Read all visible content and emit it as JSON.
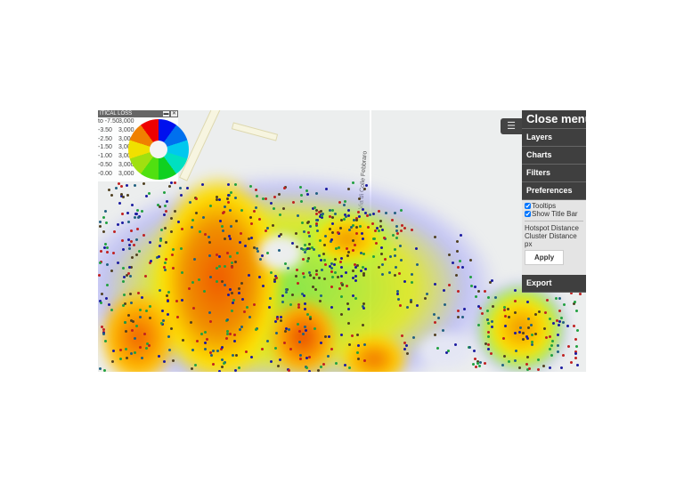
{
  "legend": {
    "title": "ITICAL LOSS",
    "rows": [
      {
        "range": "to -7.50",
        "count": "3,000"
      },
      {
        "range": "-3.50",
        "count": "3,000"
      },
      {
        "range": "-2.50",
        "count": "3,000"
      },
      {
        "range": "-1.50",
        "count": "3,000"
      },
      {
        "range": "-1.00",
        "count": "3,000"
      },
      {
        "range": "-0.50",
        "count": "3,000"
      },
      {
        "range": "-0.00",
        "count": "3,000"
      }
    ]
  },
  "map": {
    "street_label": "Via di Colle Febbraro"
  },
  "menu": {
    "toggle_icon": "hamburger-icon",
    "close": "Close menu",
    "layers": "Layers",
    "charts": "Charts",
    "filters": "Filters",
    "preferences": "Preferences",
    "tooltips": "Tooltips",
    "show_title_bar": "Show Title Bar",
    "hotspot_distance": "Hotspot Distance",
    "cluster_distance": "Cluster Distance",
    "px": "px",
    "apply": "Apply",
    "export": "Export"
  }
}
